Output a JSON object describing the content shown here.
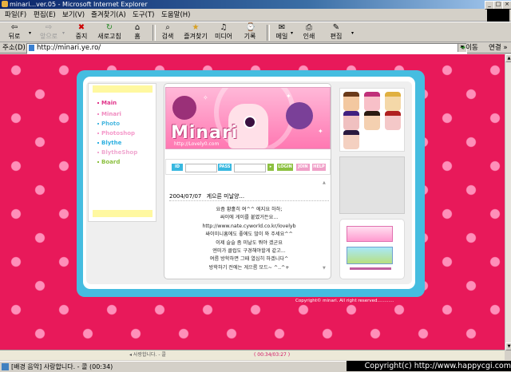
{
  "window": {
    "title": "minari...ver.05 - Microsoft Internet Explorer"
  },
  "menu": [
    "파일(F)",
    "편집(E)",
    "보기(V)",
    "즐겨찾기(A)",
    "도구(T)",
    "도움말(H)"
  ],
  "toolbar": {
    "back": "뒤로",
    "forward": "앞으로",
    "stop": "중지",
    "refresh": "새로고침",
    "home": "홈",
    "search": "검색",
    "favorites": "즐겨찾기",
    "media": "미디어",
    "history": "기록",
    "mail": "메일",
    "print": "인쇄",
    "edit": "편집"
  },
  "address": {
    "label": "주소(D)",
    "url": "http://minari.ye.ro/",
    "go": "이동",
    "links": "연결 »"
  },
  "site": {
    "nav": [
      {
        "label": "Main",
        "color": "#e0348a"
      },
      {
        "label": "Minari",
        "color": "#f08cc0"
      },
      {
        "label": "Photo",
        "color": "#4ab8e0"
      },
      {
        "label": "Photoshop",
        "color": "#f59acb"
      },
      {
        "label": "Blythe",
        "color": "#2fb0e0"
      },
      {
        "label": "BlytheShop",
        "color": "#f0a8d0"
      },
      {
        "label": "Board",
        "color": "#8cc040"
      }
    ],
    "banner": {
      "logo": "Minari",
      "url": "http://Lovely0.com"
    },
    "login": {
      "id_label": "ID",
      "pass_label": "PASS",
      "login_label": "LOGIN",
      "join_label": "JOIN",
      "help_label": "HELP"
    },
    "diary": {
      "date": "2004/07/07",
      "title": "게으른 미날양...",
      "lines": [
        "요즘 황홀히 여^^ 에지요 하하;",
        "싸이에 게이를 붙였거든요...",
        "http://www.nate.cyworld.co.kr/lovelyb",
        "싸이미니홈에도 좋에도 많이 와 주세요^^",
        "이제 슬슬 좀 미날도 뭐야 겠군요",
        "엔미가 클럽도 구경해야할게 같고...",
        "여름 방학하면 그때 열심히 하겠니다^",
        "방학하기 전에는 게으름 모드~ ^..^+"
      ]
    },
    "copyright": "Copyright© minari. All right reserved............"
  },
  "music": {
    "left": "◂ 사랑합니다. - 콜",
    "time": "( 00:34/03:27 )"
  },
  "status": {
    "text": "[배경 음악] 사랑합니다. - 콜 (00:34)"
  },
  "watermark": "Copyright(c) http://www.happycgi.com"
}
